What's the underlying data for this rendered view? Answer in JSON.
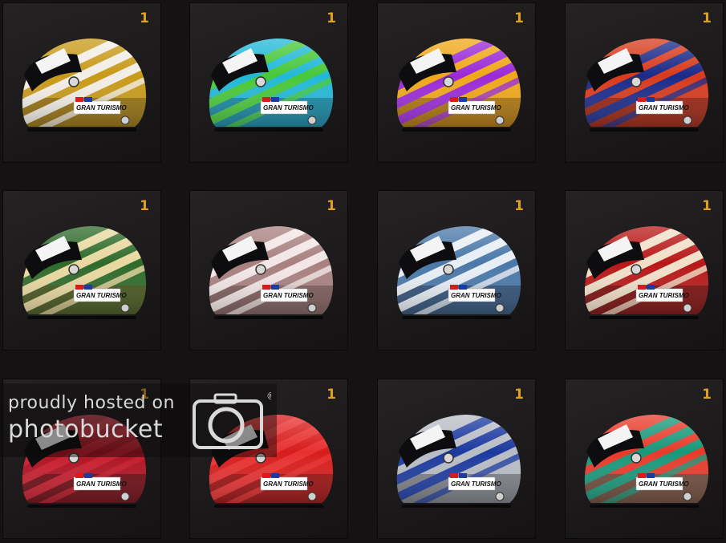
{
  "helmets": [
    {
      "count": "1",
      "brand": "GRAN TURISMO",
      "base": "#c89a1a",
      "stripe": "#f2eee6",
      "shade": "#6b5108"
    },
    {
      "count": "1",
      "brand": "GRAN TURISMO",
      "base": "#22b8d8",
      "stripe": "#48c83a",
      "shade": "#0c5e7a"
    },
    {
      "count": "1",
      "brand": "GRAN TURISMO",
      "base": "#f0a818",
      "stripe": "#9a2ad8",
      "shade": "#7a4a06"
    },
    {
      "count": "1",
      "brand": "GRAN TURISMO",
      "base": "#d83a1c",
      "stripe": "#1a2a8a",
      "shade": "#6a120a"
    },
    {
      "count": "1",
      "brand": "GRAN TURISMO",
      "base": "#2e6a2a",
      "stripe": "#e8d8a0",
      "shade": "#5a4410"
    },
    {
      "count": "1",
      "brand": "GRAN TURISMO",
      "base": "#a88080",
      "stripe": "#f2e6e6",
      "shade": "#5a3e3e"
    },
    {
      "count": "1",
      "brand": "GRAN TURISMO",
      "base": "#4a78a8",
      "stripe": "#e8eef6",
      "shade": "#1c3050"
    },
    {
      "count": "1",
      "brand": "GRAN TURISMO",
      "base": "#b81818",
      "stripe": "#f0e0c8",
      "shade": "#4a0606"
    },
    {
      "count": "1",
      "brand": "GRAN TURISMO",
      "base": "#b01020",
      "stripe": "#c81c2c",
      "shade": "#3a0408"
    },
    {
      "count": "1",
      "brand": "GRAN TURISMO",
      "base": "#d81c1c",
      "stripe": "#e83030",
      "shade": "#700808"
    },
    {
      "count": "1",
      "brand": "GRAN TURISMO",
      "base": "#b8bcc4",
      "stripe": "#1c3aa0",
      "shade": "#4a4e56"
    },
    {
      "count": "1",
      "brand": "GRAN TURISMO",
      "base": "#e83a2a",
      "stripe": "#18987a",
      "shade": "#0c5a48"
    }
  ],
  "watermark": {
    "line1": "proudly hosted on",
    "line2": "photobucket",
    "registered": "®"
  }
}
